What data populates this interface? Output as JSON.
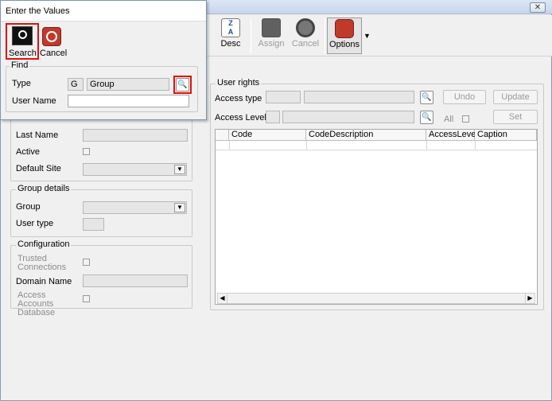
{
  "window": {
    "close_glyph": "✕"
  },
  "toolbar": {
    "desc": "Desc",
    "assign": "Assign",
    "cancel": "Cancel",
    "options": "Options"
  },
  "user_panel": {
    "last_name_label": "Last Name",
    "active_label": "Active",
    "default_site_label": "Default Site"
  },
  "group_details": {
    "caption": "Group details",
    "group_label": "Group",
    "user_type_label": "User type"
  },
  "configuration": {
    "caption": "Configuration",
    "trusted_connections_label": "Trusted Connections",
    "domain_name_label": "Domain Name",
    "access_accounts_db_label": "Access Accounts Database"
  },
  "user_rights": {
    "caption": "User rights",
    "access_type_label": "Access type",
    "access_level_label": "Access Level",
    "all_label": "All",
    "undo": "Undo",
    "update": "Update",
    "set": "Set",
    "columns": [
      "Code",
      "CodeDescription",
      "AccessLevel",
      "Caption"
    ]
  },
  "popup": {
    "title": "Enter the Values",
    "search": "Search",
    "cancel": "Cancel",
    "find": {
      "caption": "Find",
      "type_label": "Type",
      "type_code": "G",
      "type_value": "Group",
      "user_name_label": "User Name",
      "user_name_value": ""
    }
  },
  "colors": {
    "highlight": "#e01010",
    "accent": "#2a5fb0"
  }
}
